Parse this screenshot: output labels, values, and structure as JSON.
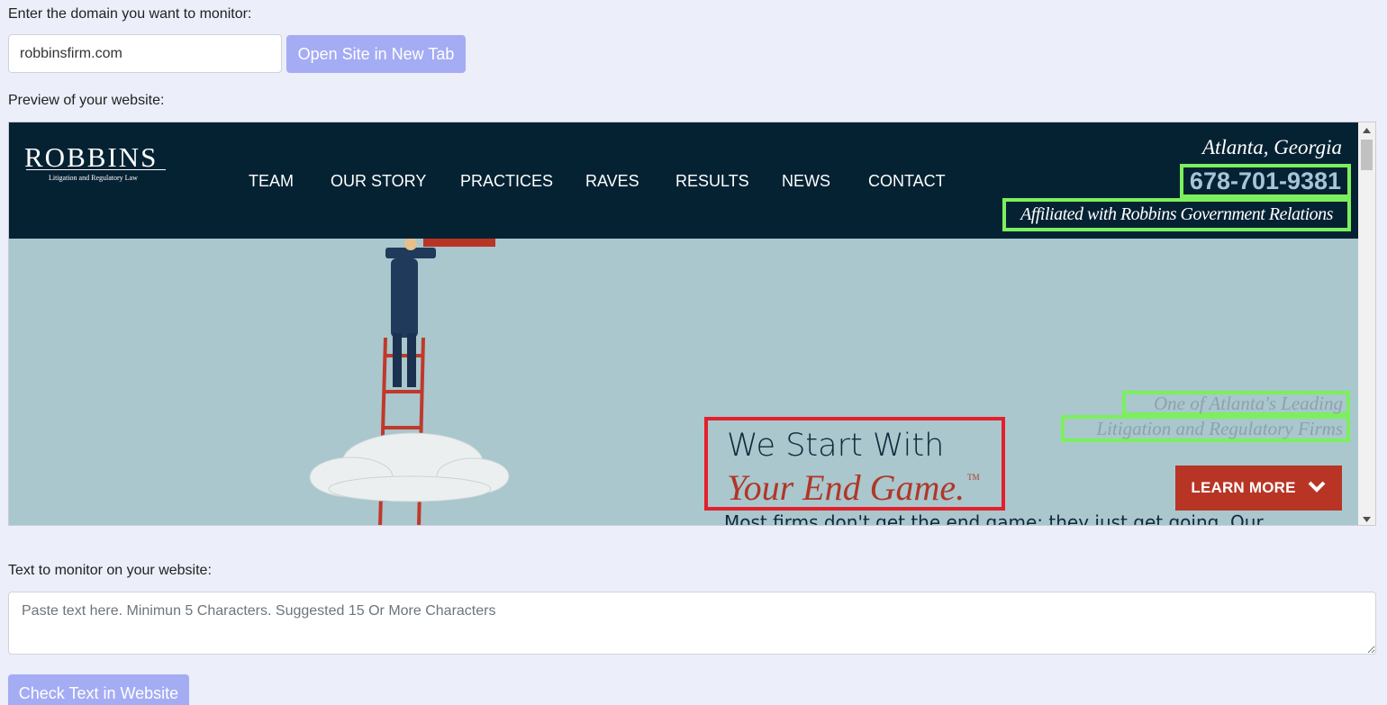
{
  "form": {
    "domain_label": "Enter the domain you want to monitor:",
    "domain_value": "robbinsfirm.com",
    "open_button": "Open Site in New Tab",
    "preview_label": "Preview of your website:",
    "monitor_label": "Text to monitor on your website:",
    "monitor_placeholder": "Paste text here. Minimun 5 Characters. Suggested 15 Or More Characters",
    "check_button": "Check Text in Website",
    "accent_color": "#a4acf4"
  },
  "site": {
    "logo": "ROBBINS",
    "logo_tagline": "Litigation and Regulatory Law",
    "nav": [
      "TEAM",
      "OUR STORY",
      "PRACTICES",
      "RAVES",
      "RESULTS",
      "NEWS",
      "CONTACT"
    ],
    "city": "Atlanta, Georgia",
    "phone": "678-701-9381",
    "affiliated": "Affiliated with Robbins Government Relations",
    "leading_line1": "One of Atlanta's Leading",
    "leading_line2": "Litigation and Regulatory Firms",
    "headline_line1": "We Start With",
    "headline_line2": "Your End Game.",
    "headline_tm": "TM",
    "learn_more": "LEARN MORE",
    "body_text": "Most firms don't get the end game; they just get going. Our",
    "header_color": "#052233",
    "highlight_match_color": "#7cf05c",
    "highlight_selected_color": "#e3202c"
  }
}
